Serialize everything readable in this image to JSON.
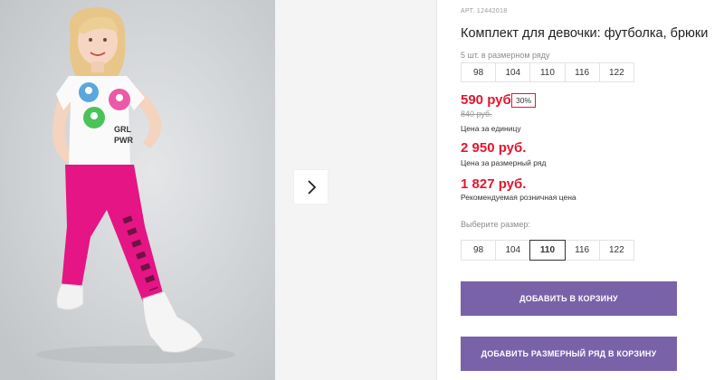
{
  "product": {
    "sku": "АРТ. 12442018",
    "title": "Комплект для девочки: футболка, брюки"
  },
  "size_range": {
    "note": "5 шт. в размерном ряду",
    "sizes": [
      "98",
      "104",
      "110",
      "116",
      "122"
    ]
  },
  "pricing": {
    "unit_price": "590 руб.",
    "discount_badge": "30%",
    "old_price": "840 руб.",
    "unit_caption": "Цена за единицу",
    "range_price": "2 950 руб.",
    "range_caption": "Цена за размерный ряд",
    "retail_price": "1 827 руб.",
    "retail_caption": "Рекомендуемая розничная цена",
    "accent_color": "#e3162f"
  },
  "size_select": {
    "label": "Выберите размер:",
    "options": [
      "98",
      "104",
      "110",
      "116",
      "122"
    ],
    "selected": "110"
  },
  "actions": {
    "add_to_cart": "ДОБАВИТЬ В КОРЗИНУ",
    "add_range_to_cart": "ДОБАВИТЬ РАЗМЕРНЫЙ РЯД В КОРЗИНУ",
    "button_color": "#7a62a8"
  },
  "gallery": {
    "next_icon": "chevron-right-icon",
    "tshirt_print": [
      "GRL",
      "PWR"
    ]
  }
}
